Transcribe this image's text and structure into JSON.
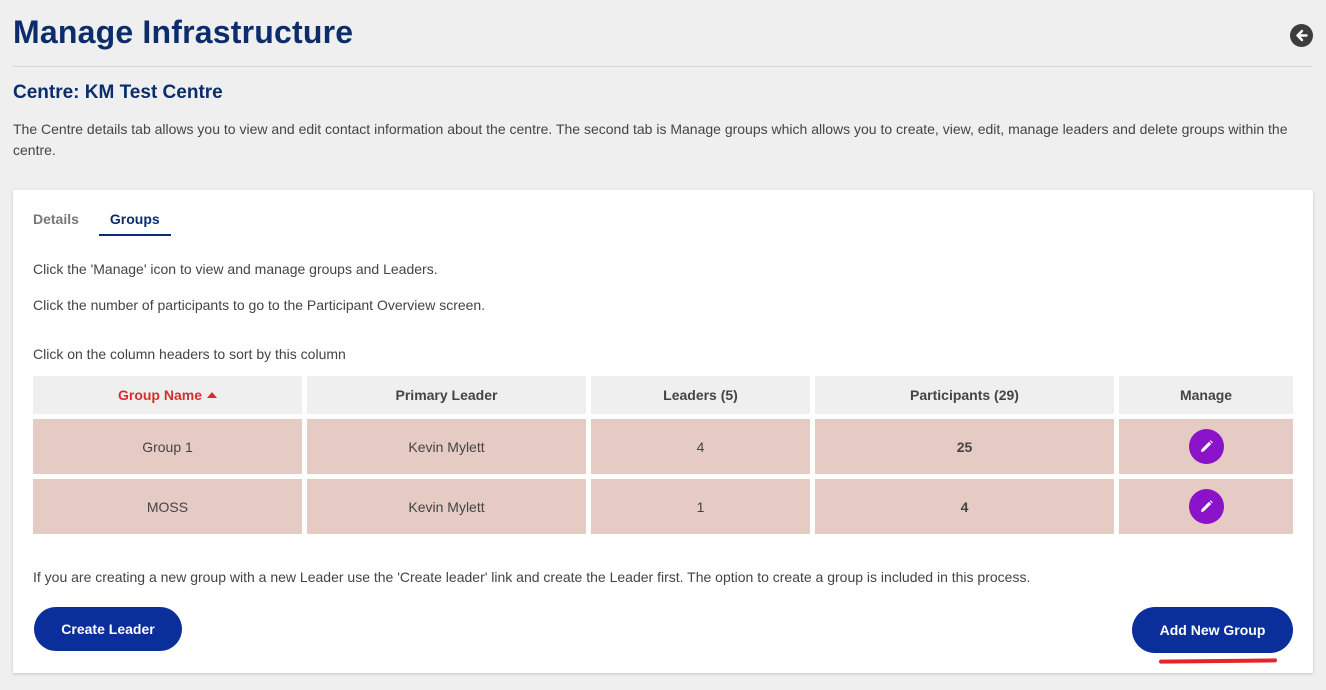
{
  "header": {
    "title": "Manage Infrastructure",
    "back_icon": "arrow-left-circle-icon"
  },
  "centre": {
    "heading": "Centre: KM Test Centre",
    "intro": "The Centre details tab allows you to view and edit contact information about the centre. The second tab is Manage groups which allows you to create, view, edit, manage leaders and delete groups within the centre."
  },
  "tabs": [
    {
      "label": "Details",
      "active": false
    },
    {
      "label": "Groups",
      "active": true
    }
  ],
  "instructions": {
    "manage": "Click the 'Manage' icon to view and manage groups and Leaders.",
    "participants": "Click the number of participants to go to the Participant Overview screen.",
    "sort": "Click on the column headers to sort by this column"
  },
  "table": {
    "columns": [
      "Group Name",
      "Primary Leader",
      "Leaders (5)",
      "Participants (29)",
      "Manage"
    ],
    "sorted_column": "Group Name",
    "sort_direction": "ascending",
    "rows": [
      {
        "group_name": "Group 1",
        "primary_leader": "Kevin Mylett",
        "leaders": "4",
        "participants": "25"
      },
      {
        "group_name": "MOSS",
        "primary_leader": "Kevin Mylett",
        "leaders": "1",
        "participants": "4"
      }
    ],
    "manage_icon": "pencil-edit-icon"
  },
  "note": "If you are creating a new group with a new Leader use the 'Create leader' link and create the Leader first. The option to create a group is included in this process.",
  "buttons": {
    "create_leader": "Create Leader",
    "add_new_group": "Add New Group"
  },
  "colors": {
    "title": "#0b2d6b",
    "button": "#0a2e9a",
    "row": "#e6cbc5",
    "manage": "#8a12c9",
    "sorted_header": "#d32f2f",
    "annotation": "#e8222a"
  }
}
